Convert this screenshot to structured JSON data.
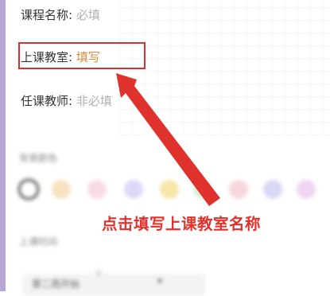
{
  "form": {
    "course_name": {
      "label": "课程名称:",
      "value": "必填"
    },
    "classroom": {
      "label": "上课教室:",
      "value": "填写"
    },
    "teacher": {
      "label": "任课教师:",
      "value": "非必填"
    }
  },
  "blurred": {
    "color_section_title": "背景颜色",
    "time_section_title": "上课时间",
    "time_value": "第二周开始",
    "time_chevron": "▾",
    "time_badge": "①"
  },
  "colors": {
    "swatches": [
      "#ffffff",
      "#f7e2c0",
      "#f8dbe3",
      "#dcd9f7",
      "#f6e6a9",
      "#d7efd9",
      "#f7d7dc",
      "#d9d8f5",
      "#efd6f1"
    ],
    "annotation": "#e0322d",
    "highlight_box": "#d9302b",
    "accent_value": "#d68b3c"
  },
  "annotation": {
    "text": "点击填写上课教室名称"
  }
}
